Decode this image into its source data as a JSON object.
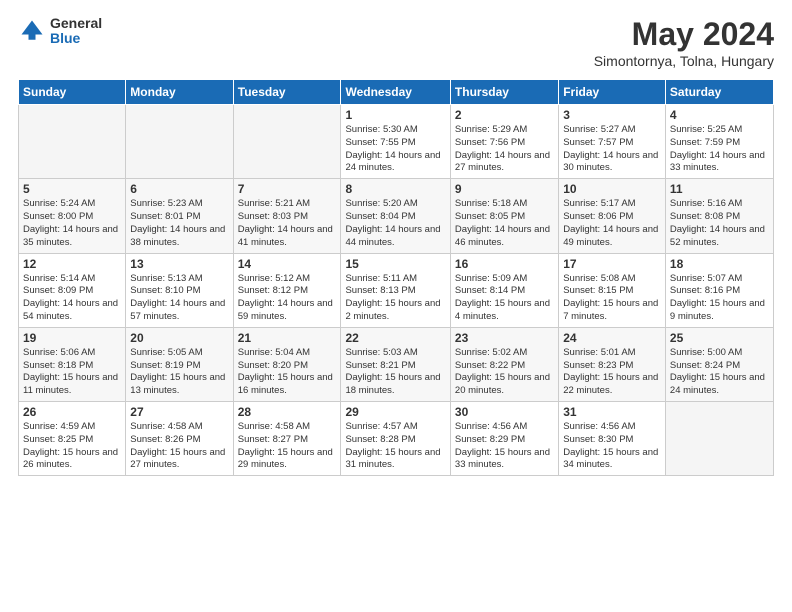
{
  "header": {
    "logo": {
      "general": "General",
      "blue": "Blue"
    },
    "title": "May 2024",
    "location": "Simontornya, Tolna, Hungary"
  },
  "weekdays": [
    "Sunday",
    "Monday",
    "Tuesday",
    "Wednesday",
    "Thursday",
    "Friday",
    "Saturday"
  ],
  "weeks": [
    [
      {
        "day": null,
        "empty": true
      },
      {
        "day": null,
        "empty": true
      },
      {
        "day": null,
        "empty": true
      },
      {
        "day": "1",
        "sunrise": "Sunrise: 5:30 AM",
        "sunset": "Sunset: 7:55 PM",
        "daylight": "Daylight: 14 hours and 24 minutes."
      },
      {
        "day": "2",
        "sunrise": "Sunrise: 5:29 AM",
        "sunset": "Sunset: 7:56 PM",
        "daylight": "Daylight: 14 hours and 27 minutes."
      },
      {
        "day": "3",
        "sunrise": "Sunrise: 5:27 AM",
        "sunset": "Sunset: 7:57 PM",
        "daylight": "Daylight: 14 hours and 30 minutes."
      },
      {
        "day": "4",
        "sunrise": "Sunrise: 5:25 AM",
        "sunset": "Sunset: 7:59 PM",
        "daylight": "Daylight: 14 hours and 33 minutes."
      }
    ],
    [
      {
        "day": "5",
        "sunrise": "Sunrise: 5:24 AM",
        "sunset": "Sunset: 8:00 PM",
        "daylight": "Daylight: 14 hours and 35 minutes."
      },
      {
        "day": "6",
        "sunrise": "Sunrise: 5:23 AM",
        "sunset": "Sunset: 8:01 PM",
        "daylight": "Daylight: 14 hours and 38 minutes."
      },
      {
        "day": "7",
        "sunrise": "Sunrise: 5:21 AM",
        "sunset": "Sunset: 8:03 PM",
        "daylight": "Daylight: 14 hours and 41 minutes."
      },
      {
        "day": "8",
        "sunrise": "Sunrise: 5:20 AM",
        "sunset": "Sunset: 8:04 PM",
        "daylight": "Daylight: 14 hours and 44 minutes."
      },
      {
        "day": "9",
        "sunrise": "Sunrise: 5:18 AM",
        "sunset": "Sunset: 8:05 PM",
        "daylight": "Daylight: 14 hours and 46 minutes."
      },
      {
        "day": "10",
        "sunrise": "Sunrise: 5:17 AM",
        "sunset": "Sunset: 8:06 PM",
        "daylight": "Daylight: 14 hours and 49 minutes."
      },
      {
        "day": "11",
        "sunrise": "Sunrise: 5:16 AM",
        "sunset": "Sunset: 8:08 PM",
        "daylight": "Daylight: 14 hours and 52 minutes."
      }
    ],
    [
      {
        "day": "12",
        "sunrise": "Sunrise: 5:14 AM",
        "sunset": "Sunset: 8:09 PM",
        "daylight": "Daylight: 14 hours and 54 minutes."
      },
      {
        "day": "13",
        "sunrise": "Sunrise: 5:13 AM",
        "sunset": "Sunset: 8:10 PM",
        "daylight": "Daylight: 14 hours and 57 minutes."
      },
      {
        "day": "14",
        "sunrise": "Sunrise: 5:12 AM",
        "sunset": "Sunset: 8:12 PM",
        "daylight": "Daylight: 14 hours and 59 minutes."
      },
      {
        "day": "15",
        "sunrise": "Sunrise: 5:11 AM",
        "sunset": "Sunset: 8:13 PM",
        "daylight": "Daylight: 15 hours and 2 minutes."
      },
      {
        "day": "16",
        "sunrise": "Sunrise: 5:09 AM",
        "sunset": "Sunset: 8:14 PM",
        "daylight": "Daylight: 15 hours and 4 minutes."
      },
      {
        "day": "17",
        "sunrise": "Sunrise: 5:08 AM",
        "sunset": "Sunset: 8:15 PM",
        "daylight": "Daylight: 15 hours and 7 minutes."
      },
      {
        "day": "18",
        "sunrise": "Sunrise: 5:07 AM",
        "sunset": "Sunset: 8:16 PM",
        "daylight": "Daylight: 15 hours and 9 minutes."
      }
    ],
    [
      {
        "day": "19",
        "sunrise": "Sunrise: 5:06 AM",
        "sunset": "Sunset: 8:18 PM",
        "daylight": "Daylight: 15 hours and 11 minutes."
      },
      {
        "day": "20",
        "sunrise": "Sunrise: 5:05 AM",
        "sunset": "Sunset: 8:19 PM",
        "daylight": "Daylight: 15 hours and 13 minutes."
      },
      {
        "day": "21",
        "sunrise": "Sunrise: 5:04 AM",
        "sunset": "Sunset: 8:20 PM",
        "daylight": "Daylight: 15 hours and 16 minutes."
      },
      {
        "day": "22",
        "sunrise": "Sunrise: 5:03 AM",
        "sunset": "Sunset: 8:21 PM",
        "daylight": "Daylight: 15 hours and 18 minutes."
      },
      {
        "day": "23",
        "sunrise": "Sunrise: 5:02 AM",
        "sunset": "Sunset: 8:22 PM",
        "daylight": "Daylight: 15 hours and 20 minutes."
      },
      {
        "day": "24",
        "sunrise": "Sunrise: 5:01 AM",
        "sunset": "Sunset: 8:23 PM",
        "daylight": "Daylight: 15 hours and 22 minutes."
      },
      {
        "day": "25",
        "sunrise": "Sunrise: 5:00 AM",
        "sunset": "Sunset: 8:24 PM",
        "daylight": "Daylight: 15 hours and 24 minutes."
      }
    ],
    [
      {
        "day": "26",
        "sunrise": "Sunrise: 4:59 AM",
        "sunset": "Sunset: 8:25 PM",
        "daylight": "Daylight: 15 hours and 26 minutes."
      },
      {
        "day": "27",
        "sunrise": "Sunrise: 4:58 AM",
        "sunset": "Sunset: 8:26 PM",
        "daylight": "Daylight: 15 hours and 27 minutes."
      },
      {
        "day": "28",
        "sunrise": "Sunrise: 4:58 AM",
        "sunset": "Sunset: 8:27 PM",
        "daylight": "Daylight: 15 hours and 29 minutes."
      },
      {
        "day": "29",
        "sunrise": "Sunrise: 4:57 AM",
        "sunset": "Sunset: 8:28 PM",
        "daylight": "Daylight: 15 hours and 31 minutes."
      },
      {
        "day": "30",
        "sunrise": "Sunrise: 4:56 AM",
        "sunset": "Sunset: 8:29 PM",
        "daylight": "Daylight: 15 hours and 33 minutes."
      },
      {
        "day": "31",
        "sunrise": "Sunrise: 4:56 AM",
        "sunset": "Sunset: 8:30 PM",
        "daylight": "Daylight: 15 hours and 34 minutes."
      },
      {
        "day": null,
        "empty": true
      }
    ]
  ]
}
